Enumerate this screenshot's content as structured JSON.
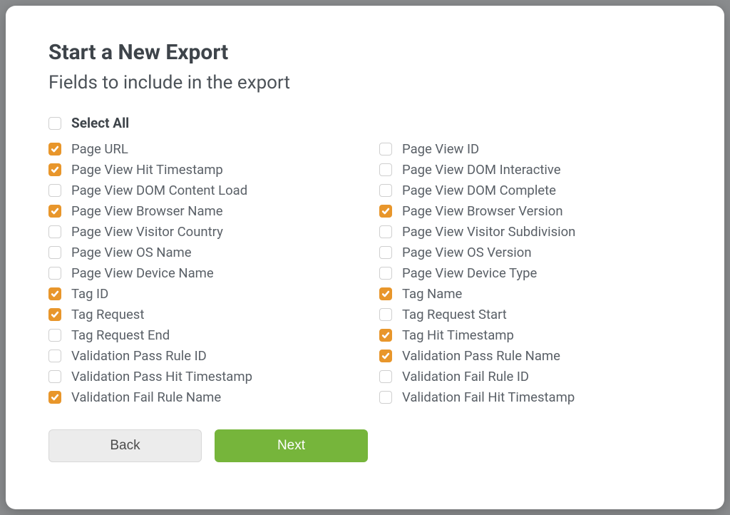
{
  "title": "Start a New Export",
  "subtitle": "Fields to include in the export",
  "selectAllLabel": "Select All",
  "selectAllChecked": false,
  "leftFields": [
    {
      "label": "Page URL",
      "checked": true
    },
    {
      "label": "Page View Hit Timestamp",
      "checked": true
    },
    {
      "label": "Page View DOM Content Load",
      "checked": false
    },
    {
      "label": "Page View Browser Name",
      "checked": true
    },
    {
      "label": "Page View Visitor Country",
      "checked": false
    },
    {
      "label": "Page View OS Name",
      "checked": false
    },
    {
      "label": "Page View Device Name",
      "checked": false
    },
    {
      "label": "Tag ID",
      "checked": true
    },
    {
      "label": "Tag Request",
      "checked": true
    },
    {
      "label": "Tag Request End",
      "checked": false
    },
    {
      "label": "Validation Pass Rule ID",
      "checked": false
    },
    {
      "label": "Validation Pass Hit Timestamp",
      "checked": false
    },
    {
      "label": "Validation Fail Rule Name",
      "checked": true
    }
  ],
  "rightFields": [
    {
      "label": "Page View ID",
      "checked": false
    },
    {
      "label": "Page View DOM Interactive",
      "checked": false
    },
    {
      "label": "Page View DOM Complete",
      "checked": false
    },
    {
      "label": "Page View Browser Version",
      "checked": true
    },
    {
      "label": "Page View Visitor Subdivision",
      "checked": false
    },
    {
      "label": "Page View OS Version",
      "checked": false
    },
    {
      "label": "Page View Device Type",
      "checked": false
    },
    {
      "label": "Tag Name",
      "checked": true
    },
    {
      "label": "Tag Request Start",
      "checked": false
    },
    {
      "label": "Tag Hit Timestamp",
      "checked": true
    },
    {
      "label": "Validation Pass Rule Name",
      "checked": true
    },
    {
      "label": "Validation Fail Rule ID",
      "checked": false
    },
    {
      "label": "Validation Fail Hit Timestamp",
      "checked": false
    }
  ],
  "buttons": {
    "back": "Back",
    "next": "Next"
  }
}
